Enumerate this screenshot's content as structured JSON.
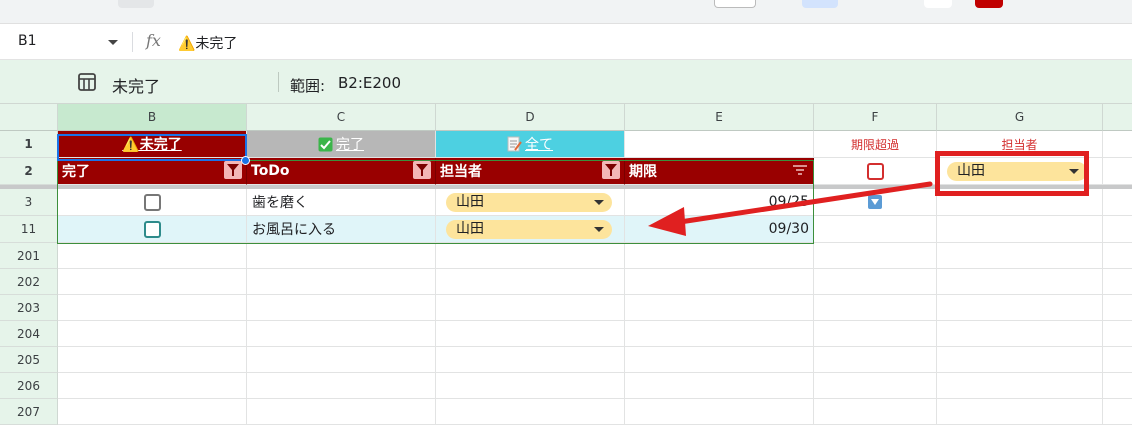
{
  "colors": {
    "accent_red": "#980000",
    "done_gray": "#b7b7b7",
    "all_cyan": "#4dd0e1",
    "chip_yellow": "#fde49c",
    "annotation_red": "#e02020"
  },
  "formula_bar": {
    "name_box": "B1",
    "fx_label": "fx",
    "content": "⚠️未完了"
  },
  "filter_view": {
    "icon": "filter-view-icon",
    "name": "未完了",
    "range_label": "範囲:",
    "range": "B2:E200"
  },
  "columns": [
    "B",
    "C",
    "D",
    "E",
    "F",
    "G"
  ],
  "rows": [
    "1",
    "2",
    "3",
    "11",
    "201",
    "202",
    "203",
    "204",
    "205",
    "206",
    "207"
  ],
  "tabs": {
    "incomplete": "⚠️未完了",
    "complete": "完了",
    "all": "全て"
  },
  "headers": {
    "done": "完了",
    "todo": "ToDo",
    "assignee": "担当者",
    "deadline": "期限"
  },
  "side": {
    "overdue_label": "期限超過",
    "assignee_label": "担当者",
    "assignee_value": "山田"
  },
  "table": [
    {
      "todo": "歯を磨く",
      "assignee": "山田",
      "deadline": "09/25"
    },
    {
      "todo": "お風呂に入る",
      "assignee": "山田",
      "deadline": "09/30"
    }
  ]
}
